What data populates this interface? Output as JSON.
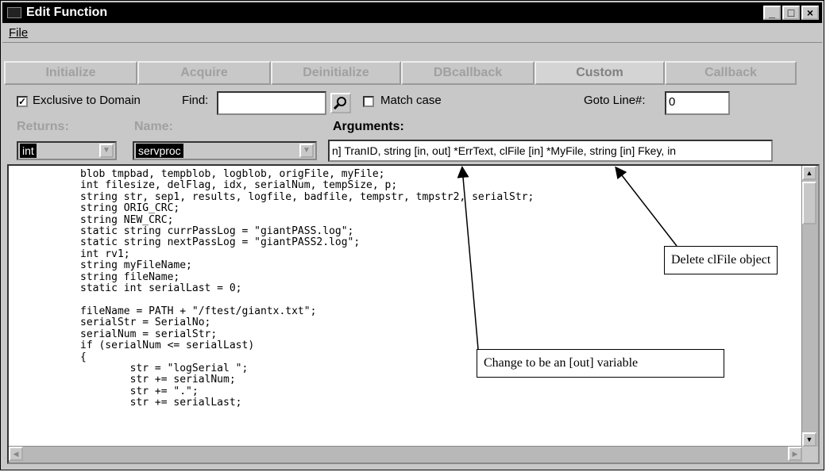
{
  "window": {
    "title": "Edit Function",
    "min": "_",
    "max": "□",
    "close": "×"
  },
  "menu": {
    "file": "File"
  },
  "tabs": [
    "Initialize",
    "Acquire",
    "Deinitialize",
    "DBcallback",
    "Custom",
    "Callback"
  ],
  "options": {
    "exclusive_label": "Exclusive to Domain",
    "exclusive_checked": "✓",
    "find_label": "Find:",
    "find_value": "",
    "match_case_label": "Match case",
    "goto_label": "Goto Line#:",
    "goto_value": "0"
  },
  "labels": {
    "returns": "Returns:",
    "name": "Name:",
    "arguments": "Arguments:"
  },
  "returns_value": "int",
  "name_value": "servproc",
  "arguments_value": "n] TranID, string [in, out] *ErrText, clFile [in] *MyFile, string [in] Fkey, in",
  "code": [
    "blob tmpbad, tempblob, logblob, origFile, myFile;",
    "int filesize, delFlag, idx, serialNum, tempSize, p;",
    "string str, sep1, results, logfile, badfile, tempstr, tmpstr2, serialStr;",
    "string ORIG_CRC;",
    "string NEW_CRC;",
    "static string currPassLog = \"giantPASS.log\";",
    "static string nextPassLog = \"giantPASS2.log\";",
    "int rv1;",
    "string myFileName;",
    "string fileName;",
    "static int serialLast = 0;",
    "",
    "fileName = PATH + \"/ftest/giantx.txt\";",
    "serialStr = SerialNo;",
    "serialNum = serialStr;",
    "if (serialNum <= serialLast)",
    "{",
    "        str = \"logSerial \";",
    "        str += serialNum;",
    "        str += \".\";",
    "        str += serialLast;"
  ],
  "callouts": {
    "delete": "Delete clFile object",
    "change": "Change to be an [out] variable"
  }
}
